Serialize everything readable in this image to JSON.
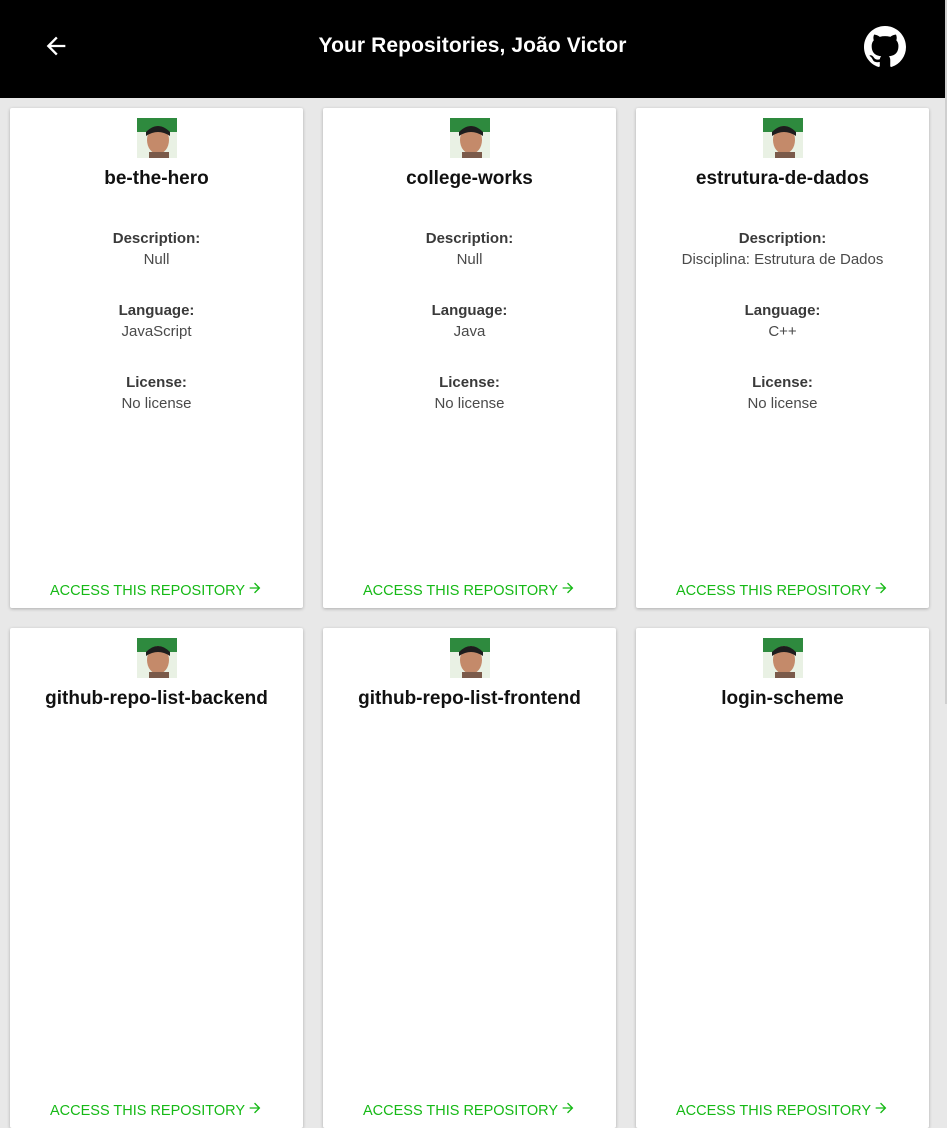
{
  "header": {
    "title": "Your Repositories, João Victor",
    "back_icon": "arrow-left-icon",
    "github_icon": "github-icon"
  },
  "labels": {
    "description": "Description:",
    "language": "Language:",
    "license": "License:",
    "access": "ACCESS THIS REPOSITORY"
  },
  "colors": {
    "header_bg": "#000000",
    "accent": "#16b916",
    "page_bg": "#e8e8e8"
  },
  "repos": [
    {
      "name": "be-the-hero",
      "description": "Null",
      "language": "JavaScript",
      "license": "No license"
    },
    {
      "name": "college-works",
      "description": "Null",
      "language": "Java",
      "license": "No license"
    },
    {
      "name": "estrutura-de-dados",
      "description": "Disciplina: Estrutura de Dados",
      "language": "C++",
      "license": "No license"
    },
    {
      "name": "github-repo-list-backend"
    },
    {
      "name": "github-repo-list-frontend"
    },
    {
      "name": "login-scheme"
    }
  ]
}
